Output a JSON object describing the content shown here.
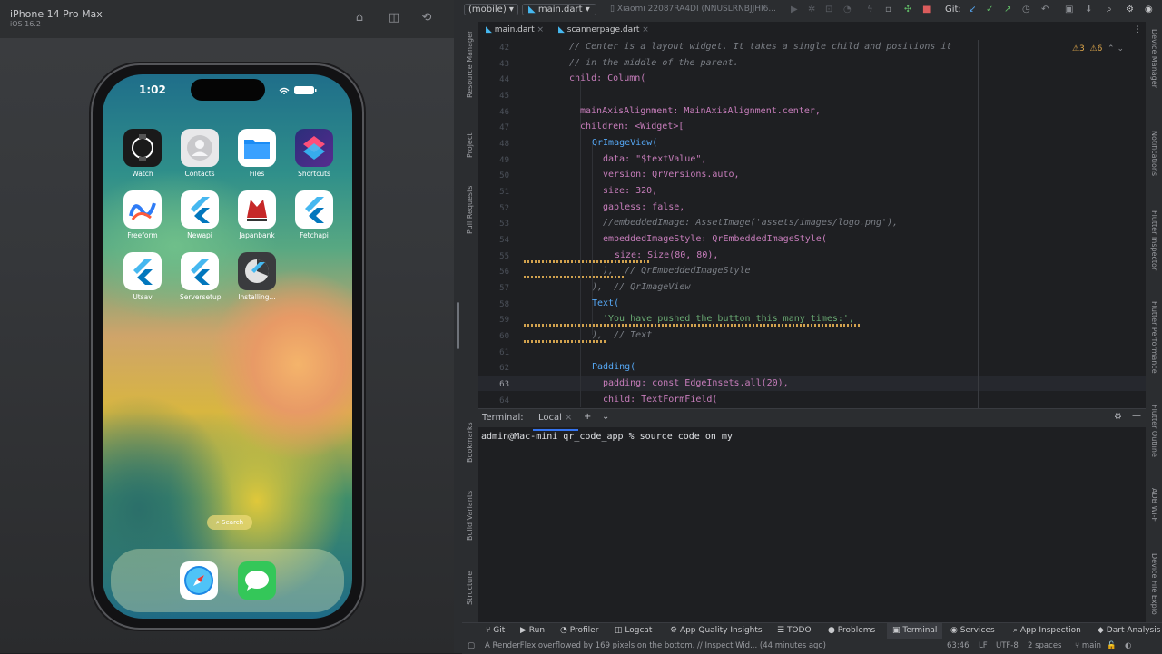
{
  "simulator": {
    "device_name": "iPhone 14 Pro Max",
    "os_version": "iOS 16.2",
    "status_time": "1:02",
    "apps": [
      {
        "label": "Watch",
        "icon": "watch-icon",
        "color": "#1a1a1a"
      },
      {
        "label": "Contacts",
        "icon": "contacts-icon",
        "color": "#e8e8ea"
      },
      {
        "label": "Files",
        "icon": "files-icon",
        "color": "#ffffff"
      },
      {
        "label": "Shortcuts",
        "icon": "shortcuts-icon",
        "color": "#3b2f8f"
      },
      {
        "label": "Freeform",
        "icon": "freeform-icon",
        "color": "#ffffff"
      },
      {
        "label": "Newapi",
        "icon": "flutter-icon",
        "color": "#ffffff"
      },
      {
        "label": "Japanbank",
        "icon": "japanbank-icon",
        "color": "#ffffff"
      },
      {
        "label": "Fetchapi",
        "icon": "flutter-icon",
        "color": "#ffffff"
      },
      {
        "label": "Utsav",
        "icon": "flutter-icon",
        "color": "#ffffff"
      },
      {
        "label": "Serversetup",
        "icon": "flutter-icon",
        "color": "#ffffff"
      },
      {
        "label": "Installing...",
        "icon": "installing-icon",
        "color": "#3a3b3e"
      }
    ],
    "search_label": "Search",
    "dock_apps": [
      "safari-icon",
      "messages-icon"
    ]
  },
  "toolbar": {
    "run_config": "(mobile)",
    "file_selector": "main.dart",
    "device_selector": "Xiaomi 22087RA4DI (NNUSLRNBJJHI6...",
    "git_label": "Git:"
  },
  "tabs": [
    {
      "label": "main.dart",
      "active": false
    },
    {
      "label": "scannerpage.dart",
      "active": true
    }
  ],
  "left_tools": [
    "Resource Manager",
    "Project",
    "Pull Requests",
    "Bookmarks",
    "Build Variants",
    "Structure"
  ],
  "right_tools": [
    "Device Manager",
    "Notifications",
    "Flutter Inspector",
    "Flutter Performance",
    "Flutter Outline",
    "ADB Wi-Fi",
    "Device File Explo"
  ],
  "inspections": {
    "errors": "3",
    "warnings": "6"
  },
  "code_lines": [
    {
      "n": "42",
      "text": "// Center is a layout widget. It takes a single child and positions it"
    },
    {
      "n": "43",
      "text": "// in the middle of the parent."
    },
    {
      "n": "44",
      "text": "child: Column("
    },
    {
      "n": "45",
      "text": ""
    },
    {
      "n": "46",
      "text": "mainAxisAlignment: MainAxisAlignment.center,"
    },
    {
      "n": "47",
      "text": "children: <Widget>["
    },
    {
      "n": "48",
      "text": "QrImageView("
    },
    {
      "n": "49",
      "text": "data: \"$textValue\","
    },
    {
      "n": "50",
      "text": "version: QrVersions.auto,"
    },
    {
      "n": "51",
      "text": "size: 320,"
    },
    {
      "n": "52",
      "text": "gapless: false,"
    },
    {
      "n": "53",
      "text": "//embeddedImage: AssetImage('assets/images/logo.png'),"
    },
    {
      "n": "54",
      "text": "embeddedImageStyle: QrEmbeddedImageStyle("
    },
    {
      "n": "55",
      "text": "size: Size(80, 80),"
    },
    {
      "n": "56",
      "text": "),  // QrEmbeddedImageStyle"
    },
    {
      "n": "57",
      "text": "),  // QrImageView"
    },
    {
      "n": "58",
      "text": "Text("
    },
    {
      "n": "59",
      "text": "'You have pushed the button this many times:',"
    },
    {
      "n": "60",
      "text": "),  // Text"
    },
    {
      "n": "61",
      "text": ""
    },
    {
      "n": "62",
      "text": "Padding("
    },
    {
      "n": "63",
      "text": "padding: const EdgeInsets.all(20),"
    },
    {
      "n": "64",
      "text": "child: TextFormField("
    }
  ],
  "terminal": {
    "title": "Terminal:",
    "tab": "Local",
    "prompt": "admin@Mac-mini qr_code_app % source code on my"
  },
  "bottom_tools": [
    "Git",
    "Run",
    "Profiler",
    "Logcat",
    "App Quality Insights",
    "TODO",
    "Problems",
    "Terminal",
    "Services",
    "App Inspection",
    "Dart Analysis"
  ],
  "status": {
    "message": "A RenderFlex overflowed by 169 pixels on the bottom. // Inspect Wid... (44 minutes ago)",
    "position": "63:46",
    "line_ending": "LF",
    "encoding": "UTF-8",
    "indent": "2 spaces",
    "branch": "main"
  },
  "colors": {
    "accent": "#3574f0",
    "keyword": "#cf8e6d",
    "string": "#6aab73",
    "class": "#ffc66d"
  }
}
